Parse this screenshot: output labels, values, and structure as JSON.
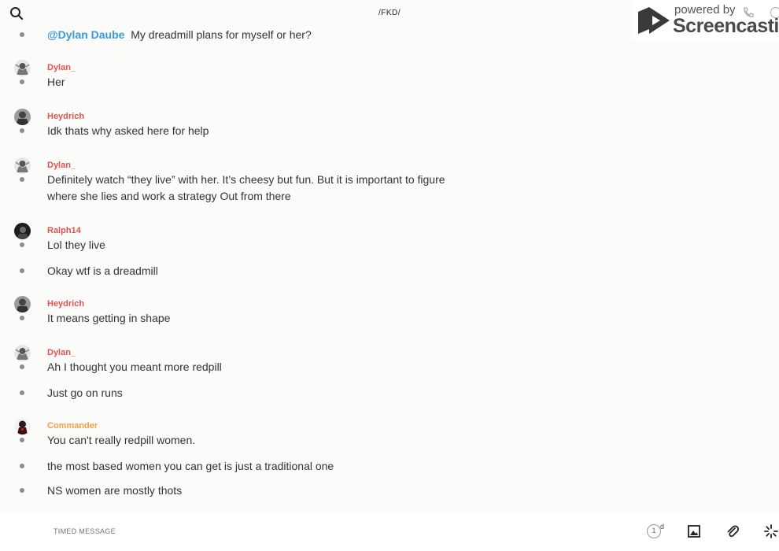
{
  "header": {
    "channel": "/FKD/"
  },
  "watermark": {
    "powered_by": "powered by",
    "brand": "Screencastify"
  },
  "messages": [
    {
      "kind": "cont",
      "mention": "@Dylan Daube",
      "text": "My dreadmill plans for myself or her?"
    },
    {
      "kind": "head",
      "author": "Dylan_",
      "avatar": "dylan",
      "text": "Her"
    },
    {
      "kind": "head",
      "author": "Heydrich",
      "avatar": "heydrich",
      "text": "Idk thats why asked here for help"
    },
    {
      "kind": "head",
      "author": "Dylan_",
      "avatar": "dylan",
      "text": "Definitely watch “they live” with her. It’s cheesy but fun. But it is important to figure where she lies and work a strategy Out from there"
    },
    {
      "kind": "head",
      "author": "Ralph14",
      "avatar": "ralph",
      "text": "Lol they live"
    },
    {
      "kind": "cont",
      "text": "Okay wtf is a dreadmill"
    },
    {
      "kind": "head",
      "author": "Heydrich",
      "avatar": "heydrich",
      "text": "It means getting in shape"
    },
    {
      "kind": "head",
      "author": "Dylan_",
      "avatar": "dylan",
      "text": "Ah I thought you meant more redpill"
    },
    {
      "kind": "cont",
      "text": "Just go on runs"
    },
    {
      "kind": "head",
      "author": "Commander",
      "avatar": "commander",
      "text": "You can't really redpill women."
    },
    {
      "kind": "cont",
      "text": "the most based women you can get is just a traditional one"
    },
    {
      "kind": "cont",
      "text": "NS women are mostly thots"
    }
  ],
  "composer": {
    "placeholder": "TIMED MESSAGE",
    "timer_value": "1",
    "timer_unit": "d"
  },
  "colors": {
    "author": "#e0524d",
    "author_alt": "#f0a048",
    "mention": "#3a9bd9"
  }
}
